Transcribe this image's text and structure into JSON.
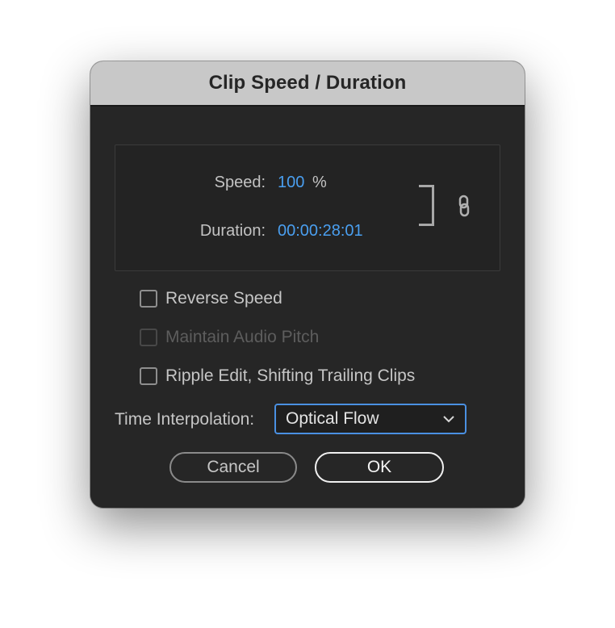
{
  "dialog": {
    "title": "Clip Speed / Duration"
  },
  "speed": {
    "label": "Speed:",
    "value": "100",
    "unit": "%"
  },
  "duration": {
    "label": "Duration:",
    "value": "00:00:28:01"
  },
  "link": {
    "icon": "link-icon",
    "linked": true
  },
  "options": {
    "reverse_speed": {
      "label": "Reverse Speed",
      "checked": false,
      "enabled": true
    },
    "maintain_audio_pitch": {
      "label": "Maintain Audio Pitch",
      "checked": false,
      "enabled": false
    },
    "ripple_edit": {
      "label": "Ripple Edit, Shifting Trailing Clips",
      "checked": false,
      "enabled": true
    }
  },
  "time_interpolation": {
    "label": "Time Interpolation:",
    "selected": "Optical Flow",
    "icon": "chevron-down-icon"
  },
  "buttons": {
    "cancel": "Cancel",
    "ok": "OK"
  },
  "colors": {
    "accent_value": "#4a9ff0",
    "select_border": "#4a90e2",
    "titlebar": "#c8c8c8",
    "background": "#262626"
  }
}
